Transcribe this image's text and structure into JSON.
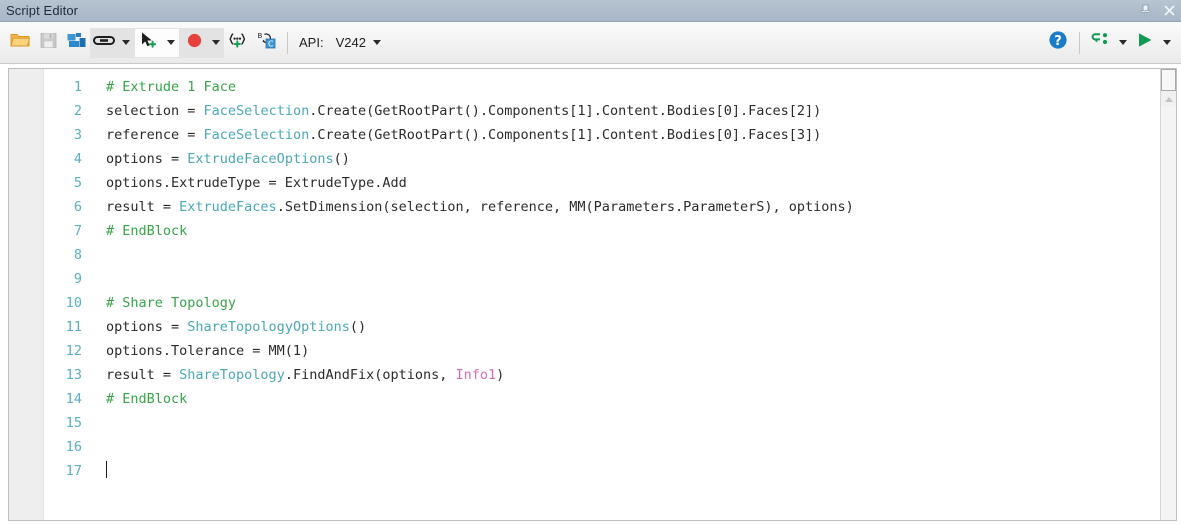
{
  "window": {
    "title": "Script Editor",
    "pin_tooltip": "Auto Hide",
    "close_tooltip": "Close"
  },
  "toolbar": {
    "open_label": "Open",
    "save_label": "Save",
    "insert_label": "Insert",
    "link_label": "Link",
    "select_label": "Select",
    "record_label": "Record",
    "parameter_label": "Insert Parameter",
    "bc_label": "Beta to C#",
    "api_label": "API:",
    "api_version": "V242",
    "help_label": "Help",
    "debug_label": "Debug",
    "run_label": "Run"
  },
  "editor": {
    "lines": [
      {
        "num": "1",
        "tokens": [
          {
            "t": "comment",
            "s": "# Extrude 1 Face"
          }
        ]
      },
      {
        "num": "2",
        "tokens": [
          {
            "t": "plain",
            "s": "selection = "
          },
          {
            "t": "type",
            "s": "FaceSelection"
          },
          {
            "t": "plain",
            "s": ".Create(GetRootPart().Components[1].Content.Bodies[0].Faces[2])"
          }
        ]
      },
      {
        "num": "3",
        "tokens": [
          {
            "t": "plain",
            "s": "reference = "
          },
          {
            "t": "type",
            "s": "FaceSelection"
          },
          {
            "t": "plain",
            "s": ".Create(GetRootPart().Components[1].Content.Bodies[0].Faces[3])"
          }
        ]
      },
      {
        "num": "4",
        "tokens": [
          {
            "t": "plain",
            "s": "options = "
          },
          {
            "t": "type",
            "s": "ExtrudeFaceOptions"
          },
          {
            "t": "plain",
            "s": "()"
          }
        ]
      },
      {
        "num": "5",
        "tokens": [
          {
            "t": "plain",
            "s": "options.ExtrudeType = ExtrudeType.Add"
          }
        ]
      },
      {
        "num": "6",
        "tokens": [
          {
            "t": "plain",
            "s": "result = "
          },
          {
            "t": "type",
            "s": "ExtrudeFaces"
          },
          {
            "t": "plain",
            "s": ".SetDimension(selection, reference, MM(Parameters.ParameterS), options)"
          }
        ]
      },
      {
        "num": "7",
        "tokens": [
          {
            "t": "comment",
            "s": "# EndBlock"
          }
        ]
      },
      {
        "num": "8",
        "tokens": []
      },
      {
        "num": "9",
        "tokens": []
      },
      {
        "num": "10",
        "tokens": [
          {
            "t": "comment",
            "s": "# Share Topology"
          }
        ]
      },
      {
        "num": "11",
        "tokens": [
          {
            "t": "plain",
            "s": "options = "
          },
          {
            "t": "type",
            "s": "ShareTopologyOptions"
          },
          {
            "t": "plain",
            "s": "()"
          }
        ]
      },
      {
        "num": "12",
        "tokens": [
          {
            "t": "plain",
            "s": "options.Tolerance = MM(1)"
          }
        ]
      },
      {
        "num": "13",
        "tokens": [
          {
            "t": "plain",
            "s": "result = "
          },
          {
            "t": "type",
            "s": "ShareTopology"
          },
          {
            "t": "plain",
            "s": ".FindAndFix(options, "
          },
          {
            "t": "special",
            "s": "Info1"
          },
          {
            "t": "plain",
            "s": ")"
          }
        ]
      },
      {
        "num": "14",
        "tokens": [
          {
            "t": "comment",
            "s": "# EndBlock"
          }
        ]
      },
      {
        "num": "15",
        "tokens": []
      },
      {
        "num": "16",
        "tokens": []
      },
      {
        "num": "17",
        "tokens": [],
        "cursor": true
      }
    ]
  },
  "colors": {
    "comment": "#3aa34a",
    "type": "#4aa8b8",
    "plain": "#2b2b2b",
    "special": "#d66fb0",
    "line_number": "#57b0c4",
    "titlebar": "#aebccb",
    "accent_blue": "#1a7cc8",
    "accent_green": "#149a4e",
    "record_red": "#e03a36",
    "folder_orange": "#f0a830"
  }
}
